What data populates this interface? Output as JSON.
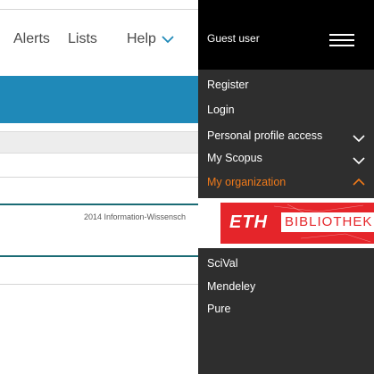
{
  "nav": {
    "alerts": "Alerts",
    "lists": "Lists",
    "help": "Help"
  },
  "footer": {
    "copyright": "2014  Information-Wissensch"
  },
  "panel": {
    "guest_label": "Guest user",
    "menu": [
      {
        "label": "Register"
      },
      {
        "label": "Login"
      },
      {
        "label": "Personal profile access"
      },
      {
        "label": "My Scopus"
      },
      {
        "label": "My organization"
      }
    ],
    "org_logo": {
      "primary": "ETH",
      "secondary": "BIBLIOTHEK"
    },
    "links": [
      {
        "label": "SciVal"
      },
      {
        "label": "Mendeley"
      },
      {
        "label": "Pure"
      }
    ]
  },
  "colors": {
    "accent": "#f07a1a",
    "link_blue": "#1f89b8",
    "panel_dark": "#2e2e2e",
    "panel_black": "#000000",
    "eth_red": "#e5252a"
  },
  "icons": {
    "help_chevron": "chevron-down-icon",
    "menu": "hamburger-icon",
    "expand": "chevron-down-icon",
    "collapse": "chevron-up-icon"
  }
}
